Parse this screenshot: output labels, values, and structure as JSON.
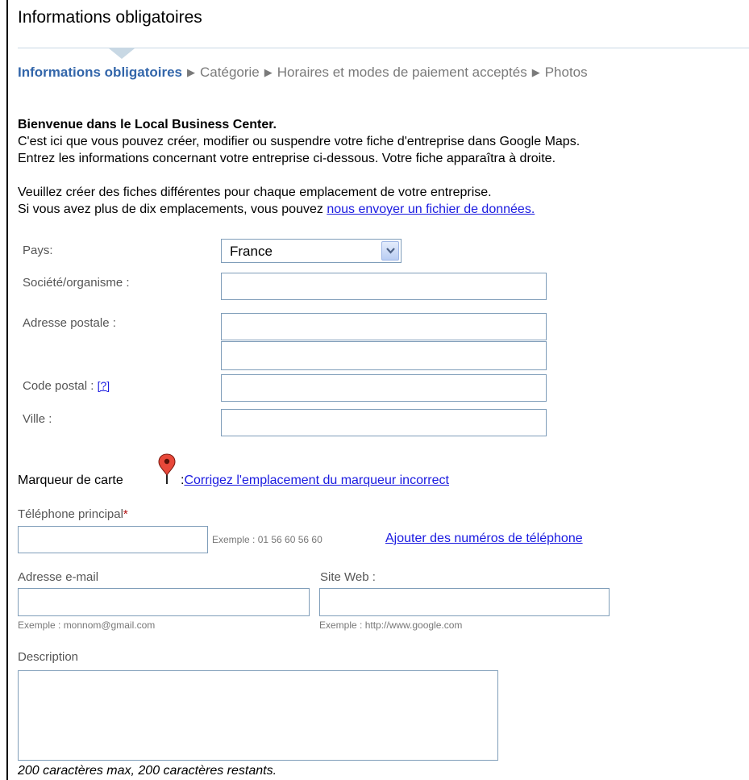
{
  "header": {
    "title": "Informations obligatoires"
  },
  "steps": [
    "Informations obligatoires",
    "Catégorie",
    "Horaires et modes de paiement acceptés",
    "Photos"
  ],
  "intro": {
    "welcome": "Bienvenue dans le Local Business Center.",
    "line1": "C'est ici que vous pouvez créer, modifier ou suspendre votre fiche d'entreprise dans Google Maps.",
    "line2": "Entrez les informations concernant votre entreprise ci-dessous. Votre fiche apparaîtra à droite.",
    "line3": "Veuillez créer des fiches différentes pour chaque emplacement de votre entreprise.",
    "line4_prefix": "Si vous avez plus de dix emplacements, vous pouvez ",
    "line4_link": "nous envoyer un fichier de données."
  },
  "form": {
    "country_label": "Pays:",
    "country_value": "France",
    "company_label": "Société/organisme :",
    "address_label": "Adresse postale :",
    "postcode_label": "Code postal :",
    "postcode_help": "[?]",
    "city_label": "Ville :",
    "marker_label": "Marqueur de carte",
    "marker_sep": ":",
    "marker_link": "Corrigez l'emplacement du marqueur incorrect",
    "phone_label": "Téléphone principal",
    "required_mark": "*",
    "phone_example": "Exemple : 01 56 60 56 60",
    "phone_add_link": "Ajouter des numéros de téléphone",
    "email_label": "Adresse e-mail",
    "email_example": "Exemple : monnom@gmail.com",
    "website_label": "Site Web :",
    "website_example": "Exemple : http://www.google.com",
    "description_label": "Description",
    "description_counter": "200 caractères max, 200 caractères restants."
  },
  "colors": {
    "active_step": "#3366aa",
    "link": "#1a1ae0",
    "input_border": "#7f9db9",
    "marker": "#e8483a"
  }
}
